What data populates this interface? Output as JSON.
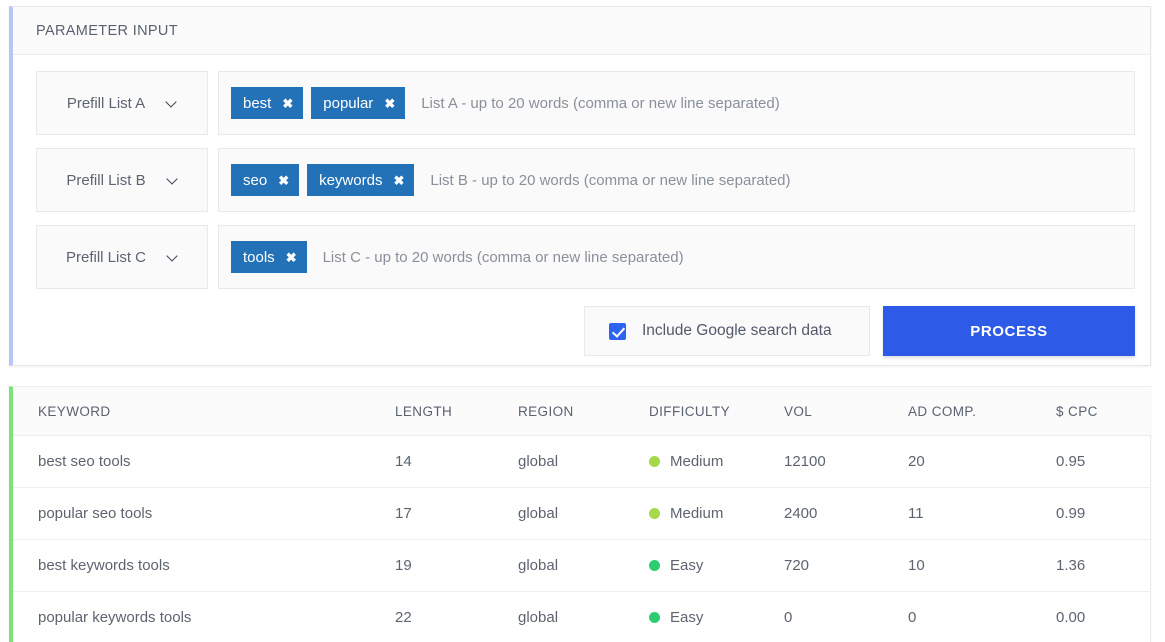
{
  "param_card": {
    "title": "PARAMETER INPUT",
    "accent_color": "#b7c6f4",
    "rows": [
      {
        "select_label": "Prefill List A",
        "tags": [
          "best",
          "popular"
        ],
        "placeholder": "List A - up to 20 words (comma or new line separated)"
      },
      {
        "select_label": "Prefill List B",
        "tags": [
          "seo",
          "keywords"
        ],
        "placeholder": "List B - up to 20 words (comma or new line separated)"
      },
      {
        "select_label": "Prefill List C",
        "tags": [
          "tools"
        ],
        "placeholder": "List C - up to 20 words (comma or new line separated)"
      }
    ],
    "tag_color": "#2372b8",
    "tag_remove_glyph": "✖",
    "chevron_icon": "chevron-down-icon"
  },
  "actions": {
    "checkbox_label": "Include Google search data",
    "checkbox_checked": true,
    "process_label": "PROCESS",
    "process_color": "#2e5ae8"
  },
  "results": {
    "accent_color": "#7ce27c",
    "columns": [
      "KEYWORD",
      "LENGTH",
      "REGION",
      "DIFFICULTY",
      "VOL",
      "AD COMP.",
      "$ CPC"
    ],
    "rows": [
      {
        "keyword": "best seo tools",
        "length": "14",
        "region": "global",
        "difficulty": "Medium",
        "difficulty_color": "#a6d949",
        "vol": "12100",
        "ad_comp": "20",
        "cpc": "0.95"
      },
      {
        "keyword": "popular seo tools",
        "length": "17",
        "region": "global",
        "difficulty": "Medium",
        "difficulty_color": "#a6d949",
        "vol": "2400",
        "ad_comp": "11",
        "cpc": "0.99"
      },
      {
        "keyword": "best keywords tools",
        "length": "19",
        "region": "global",
        "difficulty": "Easy",
        "difficulty_color": "#2ecc71",
        "vol": "720",
        "ad_comp": "10",
        "cpc": "1.36"
      },
      {
        "keyword": "popular keywords tools",
        "length": "22",
        "region": "global",
        "difficulty": "Easy",
        "difficulty_color": "#2ecc71",
        "vol": "0",
        "ad_comp": "0",
        "cpc": "0.00"
      }
    ]
  }
}
